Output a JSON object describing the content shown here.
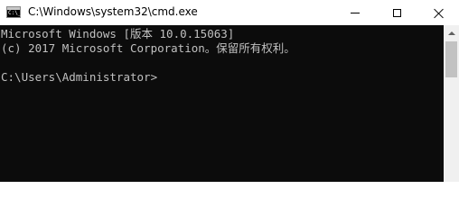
{
  "window": {
    "title": "C:\\Windows\\system32\\cmd.exe",
    "icon": "cmd-icon",
    "icon_prompt": "C:\\_"
  },
  "caption_buttons": {
    "minimize": "minimize-icon",
    "maximize": "maximize-icon",
    "close": "close-icon"
  },
  "console": {
    "lines": [
      "Microsoft Windows [版本 10.0.15063]",
      "(c) 2017 Microsoft Corporation。保留所有权利。",
      "C:\\Users\\Administrator>"
    ],
    "text_color": "#c0c0c0",
    "background": "#0c0c0c"
  },
  "scrollbar": {
    "up_arrow": "chevron-up-icon"
  }
}
